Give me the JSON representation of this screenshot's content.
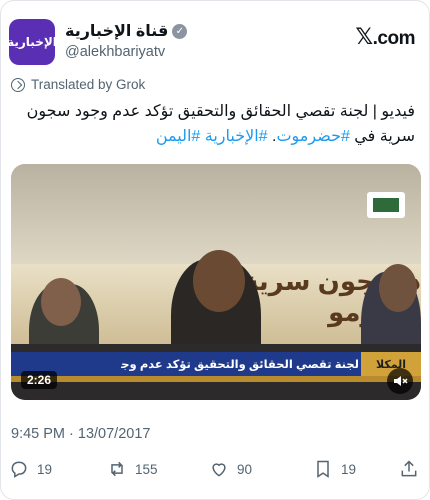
{
  "account": {
    "avatar_text": "الإخبارية",
    "name": "قناة الإخبارية",
    "handle": "@alekhbariyatv",
    "site": ".com"
  },
  "translation": {
    "label": "Translated by Grok"
  },
  "tweet": {
    "text_main": "فيديو | لجنة تقصي الحقائق والتحقيق تؤكد عدم وجود سجون سرية في ",
    "hashtag1": "#حضرموت",
    "text_mid": ". ",
    "hashtag2": "#الإخبارية",
    "hashtag3": "#اليمن"
  },
  "media": {
    "banner_text": "د سجون سرية في حضرمو",
    "ticker_text": "لجنة تقصي الحقائق والتحقيق تؤكد عدم وجود سجون سرية في حضرموت",
    "ticker_place": "المكلا",
    "duration": "2:26"
  },
  "meta": {
    "timestamp": "9:45 PM · 13/07/2017"
  },
  "actions": {
    "replies": "19",
    "reposts": "155",
    "likes": "90",
    "bookmarks": "19"
  },
  "colors": {
    "link": "#1d9bf0",
    "muted": "#536471",
    "ticker": "#1f3a8a"
  }
}
